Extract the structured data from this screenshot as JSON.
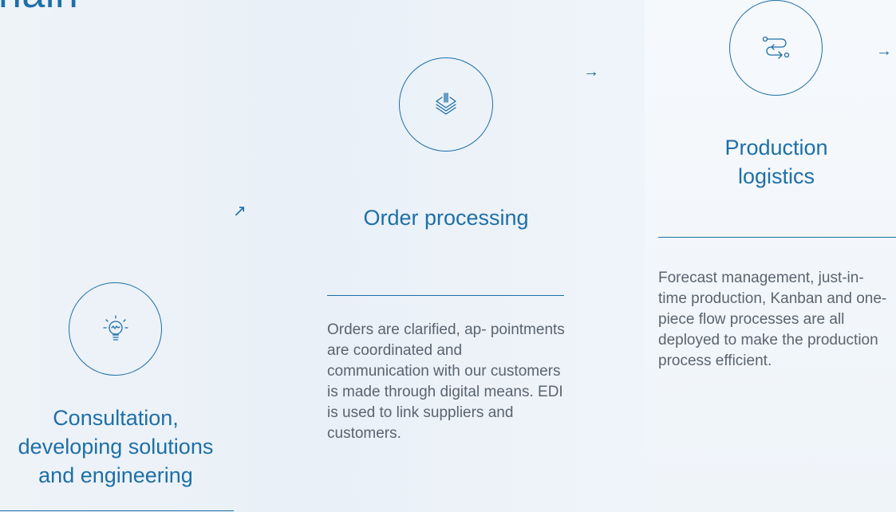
{
  "hero": {
    "title_fragment": "nain"
  },
  "steps": [
    {
      "icon": "lightbulb-icon",
      "title": "Consultation, developing solutions and engineering",
      "description": ""
    },
    {
      "icon": "layers-icon",
      "title": "Order processing",
      "description": "Orders are clarified, ap- pointments are coordinated and communication with our customers is made through digital means. EDI is used to link suppliers and customers."
    },
    {
      "icon": "route-icon",
      "title": "Production logistics",
      "description": "Forecast management, just-in-time production, Kanban and one-piece flow processes are all deployed to make the production process efficient."
    }
  ],
  "arrows": {
    "up_right": "↗",
    "right": "→"
  },
  "colors": {
    "accent": "#1e6fa8",
    "body_text": "#5a6470"
  }
}
